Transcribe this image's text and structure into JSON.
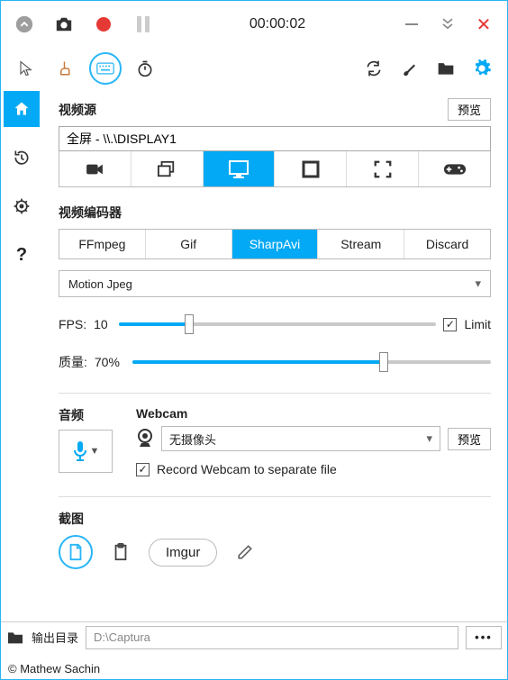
{
  "titlebar": {
    "timer": "00:00:02"
  },
  "video_source": {
    "title": "视频源",
    "preview_label": "预览",
    "value": "全屏 - \\\\.\\DISPLAY1"
  },
  "encoder": {
    "title": "视频编码器",
    "tabs": {
      "ffmpeg": "FFmpeg",
      "gif": "Gif",
      "sharpavi": "SharpAvi",
      "stream": "Stream",
      "discard": "Discard"
    },
    "codec": "Motion Jpeg",
    "fps_label": "FPS:",
    "fps_value": "10",
    "fps_pct": 22,
    "limit_label": "Limit",
    "quality_label": "质量:",
    "quality_value": "70%",
    "quality_pct": 70
  },
  "audio": {
    "title": "音频"
  },
  "webcam": {
    "title": "Webcam",
    "device": "无摄像头",
    "preview_label": "预览",
    "separate_label": "Record Webcam to separate file"
  },
  "screenshot": {
    "title": "截图",
    "imgur": "Imgur"
  },
  "footer": {
    "out_label": "输出目录",
    "path": "D:\\Captura"
  },
  "copyright": "© Mathew Sachin"
}
